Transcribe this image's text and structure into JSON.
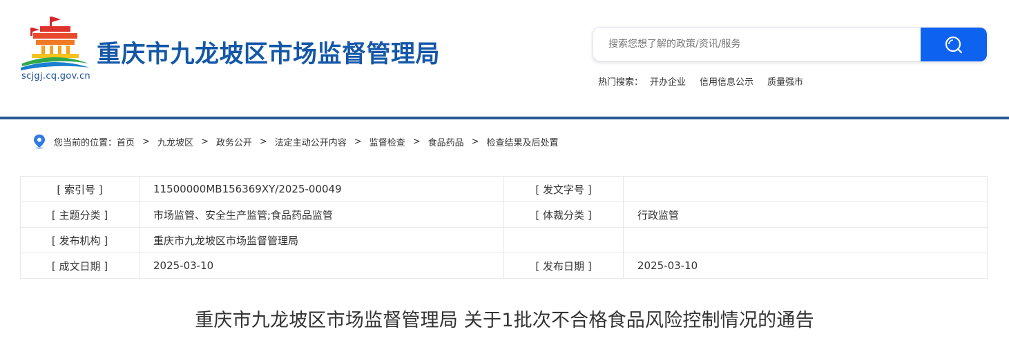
{
  "header": {
    "site_title": "重庆市九龙坡区市场监督管理局",
    "domain": "scjgj.cq.gov.cn",
    "brand_color": "#1457a8"
  },
  "search": {
    "placeholder": "搜索您想了解的政策/资讯/服务",
    "icon": "search-icon",
    "button_color": "#0d62f0"
  },
  "hot_search": {
    "label": "热门搜索：",
    "links": [
      "开办企业",
      "信用信息公示",
      "质量强市"
    ]
  },
  "breadcrumb": {
    "prefix": "您当前的位置：",
    "icon": "location-pin-icon",
    "separator": ">",
    "items": [
      "首页",
      "九龙坡区",
      "政务公开",
      "法定主动公开内容",
      "监督检查",
      "食品药品",
      "检查结果及后处置"
    ]
  },
  "meta_table": {
    "rows": [
      {
        "label1": "[ 索引号 ]",
        "value1": "11500000MB156369XY/2025-00049",
        "label2": "[ 发文字号 ]",
        "value2": ""
      },
      {
        "label1": "[ 主题分类 ]",
        "value1": "市场监管、安全生产监管;食品药品监管",
        "label2": "[ 体裁分类 ]",
        "value2": "行政监管"
      },
      {
        "label1": "[ 发布机构 ]",
        "value1": "重庆市九龙坡区市场监督管理局",
        "label2": "",
        "value2": ""
      },
      {
        "label1": "[ 成文日期 ]",
        "value1": "2025-03-10",
        "label2": "[ 发布日期 ]",
        "value2": "2025-03-10"
      }
    ]
  },
  "document": {
    "title": "重庆市九龙坡区市场监督管理局 关于1批次不合格食品风险控制情况的通告"
  }
}
